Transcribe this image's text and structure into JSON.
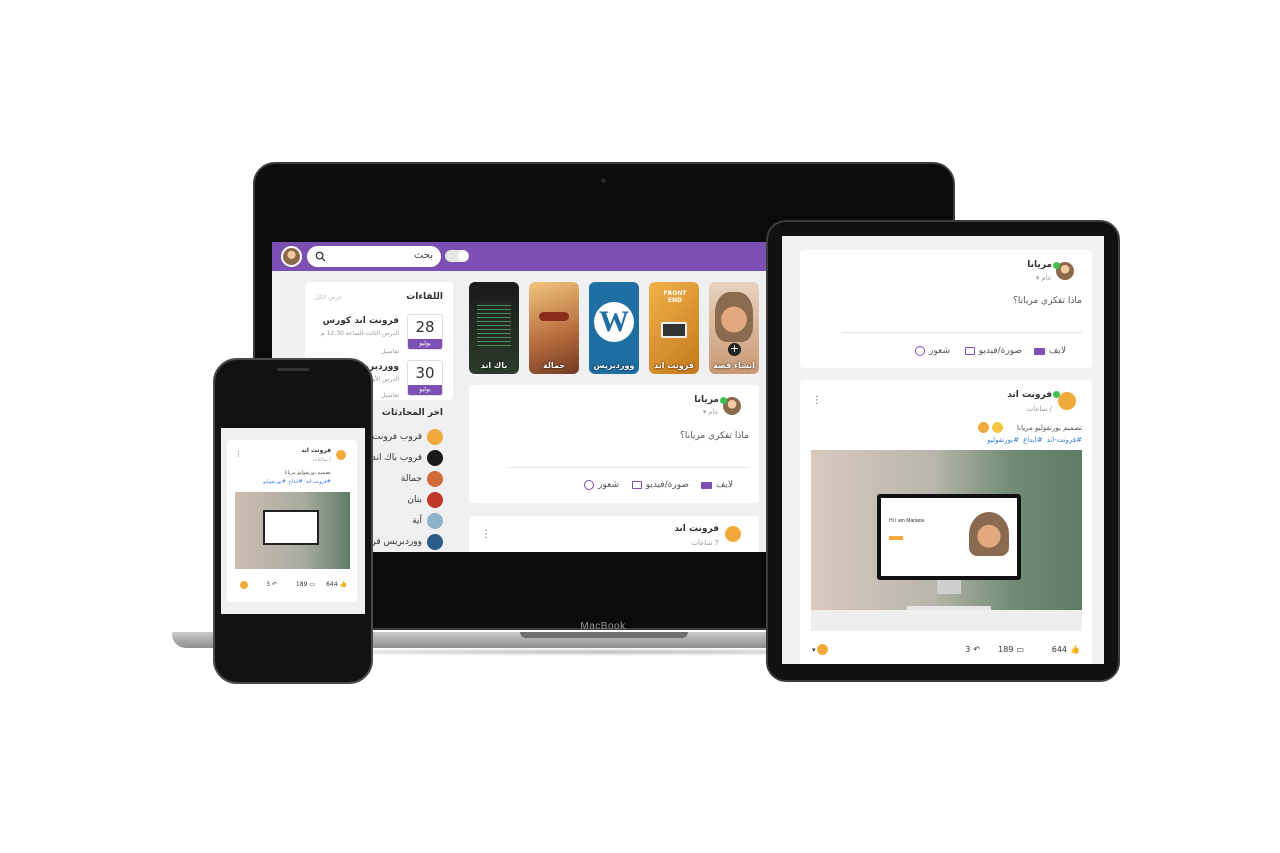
{
  "colors": {
    "accent": "#7c4fb3",
    "online": "#3fbf4f",
    "hashtag": "#3a7bd5",
    "like": "#3b6fd8"
  },
  "device": {
    "brand": "MacBook"
  },
  "header": {
    "search_placeholder": "بحث"
  },
  "stories": [
    {
      "label": "انشاء قصة",
      "icon": "plus-icon"
    },
    {
      "label": "فرونت اند"
    },
    {
      "label": "ووردبريس"
    },
    {
      "label": "جمالة"
    },
    {
      "label": "باك اند"
    }
  ],
  "composer": {
    "user": "مريانا",
    "privacy": "عام",
    "placeholder": "ماذا تفكري مريانا؟",
    "live": "لايف",
    "photo_video": "صورة/فيديو",
    "feeling": "شعور"
  },
  "post": {
    "group": "فرونت اند",
    "time": "7 ساعات",
    "time_ipad": "/ ساعات",
    "time_phone": "/ ساعات",
    "text": "تصميم بورتفوليو مريانا",
    "tags": [
      "#فرونت-اند",
      "#ابداع",
      "#بورتفوليو"
    ],
    "mock_title": "Hi I am Mariana",
    "likes": "644",
    "comments": "189",
    "shares": "3"
  },
  "meetings": {
    "title": "اللقاءات",
    "see_all": "عرض الكل",
    "items": [
      {
        "title": "فرونت اند كورس",
        "subtitle": "الدرس الثالث-الساعة 12:30 م",
        "details": "تفاصيل",
        "day": "28",
        "month": "يوليو"
      },
      {
        "title": "ووردبريس",
        "subtitle": "الدرس الأول",
        "details": "تفاصيل",
        "day": "30",
        "month": "يوليو"
      }
    ]
  },
  "chats": {
    "title": "اخر المحادثات",
    "items": [
      {
        "name": "قروب فرونت إ",
        "color": "#f2a93b"
      },
      {
        "name": "قروب باك اند",
        "color": "#1b1b1b"
      },
      {
        "name": "جمالة",
        "color": "#d36a3a"
      },
      {
        "name": "بنان",
        "color": "#c0392b"
      },
      {
        "name": "آية",
        "color": "#8fb3c9"
      },
      {
        "name": "ووردبريس قرو",
        "color": "#2b5c8a"
      }
    ]
  }
}
